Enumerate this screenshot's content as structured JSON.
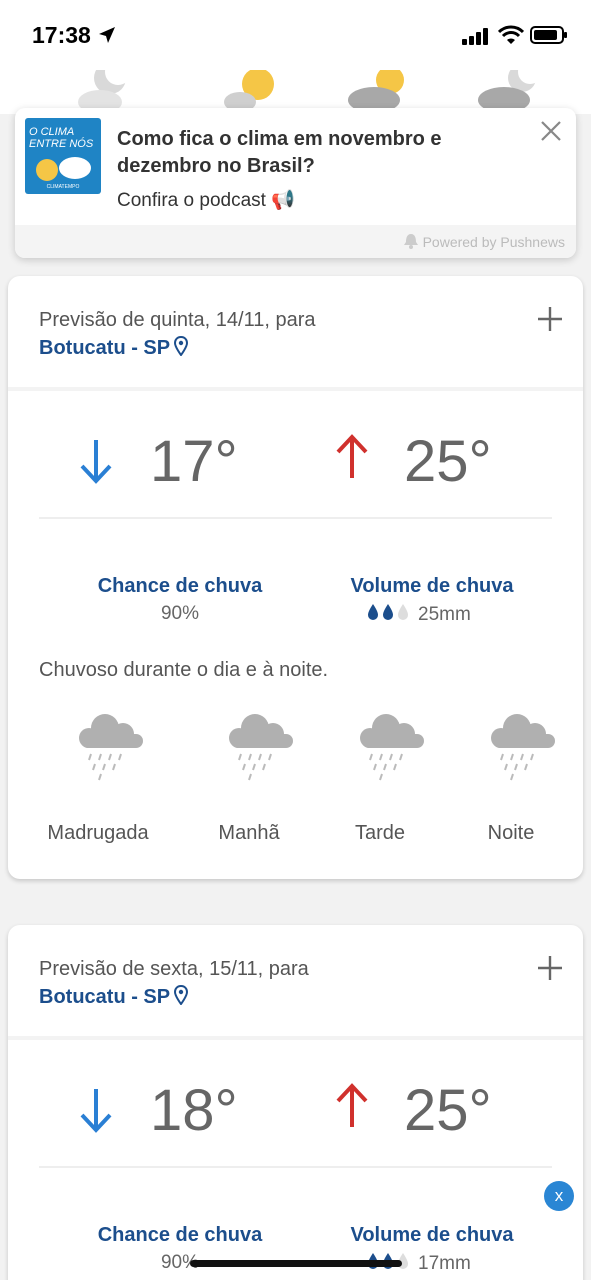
{
  "status_bar": {
    "time": "17:38"
  },
  "push_notification": {
    "thumbnail_title": "O CLIMA ENTRE NÓS",
    "thumbnail_subtitle": "CLIMATEMPO",
    "title": "Como fica o clima em novembro e dezembro no Brasil?",
    "body": "Confira o podcast 📢",
    "powered_by": "Powered by Pushnews"
  },
  "cards": [
    {
      "label": "Previsão de quinta, 14/11, para",
      "city": "Botucatu - SP",
      "min_temp": "17°",
      "max_temp": "25°",
      "chance_title": "Chance de chuva",
      "chance_value": "90%",
      "volume_title": "Volume de chuva",
      "volume_value": "25mm",
      "volume_level_drops": 2,
      "description": "Chuvoso durante o dia e à noite.",
      "periods": [
        "Madrugada",
        "Manhã",
        "Tarde",
        "Noite"
      ],
      "period_icon": "rain-cloud-icon"
    },
    {
      "label": "Previsão de sexta, 15/11, para",
      "city": "Botucatu - SP",
      "min_temp": "18°",
      "max_temp": "25°",
      "chance_title": "Chance de chuva",
      "chance_value": "90%",
      "volume_title": "Volume de chuva",
      "volume_value": "17mm",
      "volume_level_drops": 2
    }
  ],
  "floating_close": "x",
  "colors": {
    "brand_blue": "#1c4e8c",
    "arrow_down": "#2a7fd4",
    "arrow_up": "#d0312d",
    "cloud": "#b0b0b0"
  }
}
